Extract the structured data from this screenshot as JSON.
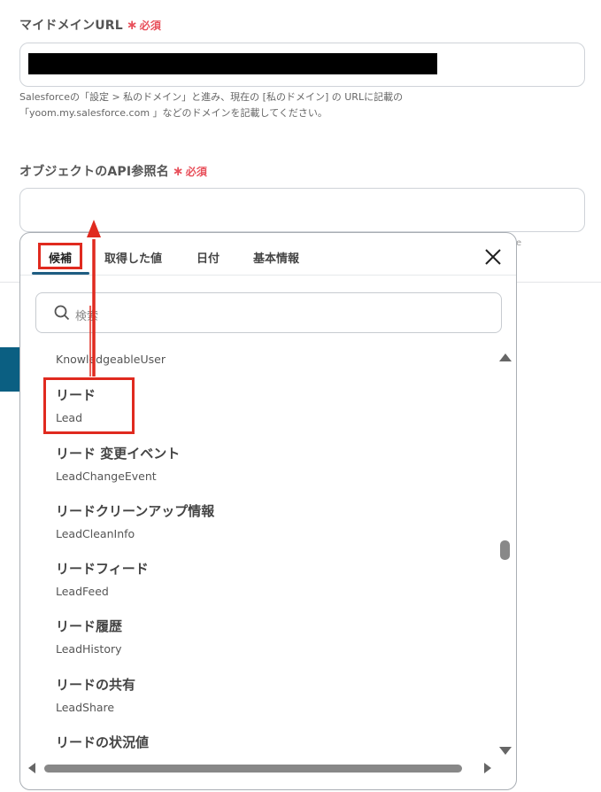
{
  "form": {
    "domain_field": {
      "label": "マイドメインURL",
      "required_text": "必須",
      "help_line1": "Salesforceの「設定 > 私のドメイン」と進み、現在の [私のドメイン] の URLに記載の",
      "help_line2": "「yoom.my.salesforce.com 」などのドメインを記載してください。"
    },
    "api_field": {
      "label": "オブジェクトのAPI参照名",
      "required_text": "必須",
      "value": ""
    },
    "trailing_char": "e"
  },
  "popup": {
    "tabs": [
      {
        "label": "候補",
        "active": true
      },
      {
        "label": "取得した値",
        "active": false
      },
      {
        "label": "日付",
        "active": false
      },
      {
        "label": "基本情報",
        "active": false
      }
    ],
    "search": {
      "placeholder": "検索"
    },
    "items": [
      {
        "title": "",
        "api_name": "KnowledgeableUser"
      },
      {
        "title": "リード",
        "api_name": "Lead"
      },
      {
        "title": "リード 変更イベント",
        "api_name": "LeadChangeEvent"
      },
      {
        "title": "リードクリーンアップ情報",
        "api_name": "LeadCleanInfo"
      },
      {
        "title": "リードフィード",
        "api_name": "LeadFeed"
      },
      {
        "title": "リード履歴",
        "api_name": "LeadHistory"
      },
      {
        "title": "リードの共有",
        "api_name": "LeadShare"
      },
      {
        "title": "リードの状況値",
        "api_name": ""
      }
    ]
  },
  "colors": {
    "required": "#e8505b",
    "highlight": "#e02a1f",
    "tab_underline": "#1e5d82",
    "accent_bar": "#0b5f82"
  },
  "icons": {
    "search": "search-icon",
    "close": "close-icon",
    "scroll_up": "triangle-up-icon",
    "scroll_down": "triangle-down-icon"
  }
}
